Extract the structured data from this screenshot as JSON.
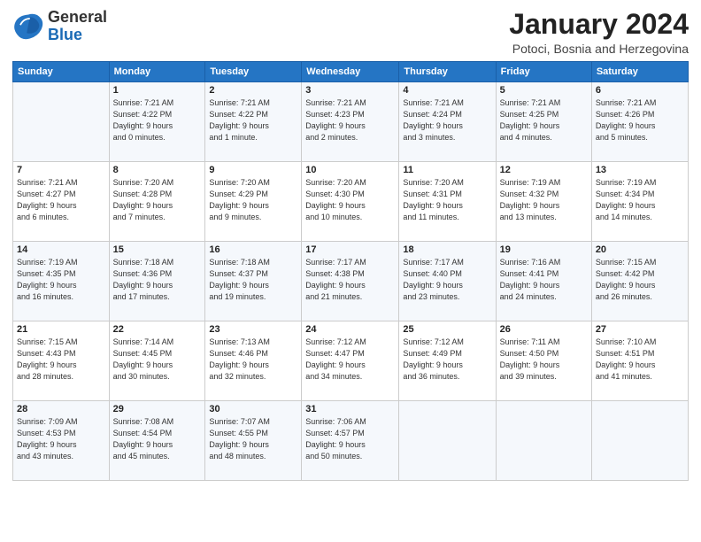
{
  "header": {
    "logo_general": "General",
    "logo_blue": "Blue",
    "month": "January 2024",
    "location": "Potoci, Bosnia and Herzegovina"
  },
  "weekdays": [
    "Sunday",
    "Monday",
    "Tuesday",
    "Wednesday",
    "Thursday",
    "Friday",
    "Saturday"
  ],
  "weeks": [
    [
      {
        "day": "",
        "info": ""
      },
      {
        "day": "1",
        "info": "Sunrise: 7:21 AM\nSunset: 4:22 PM\nDaylight: 9 hours\nand 0 minutes."
      },
      {
        "day": "2",
        "info": "Sunrise: 7:21 AM\nSunset: 4:22 PM\nDaylight: 9 hours\nand 1 minute."
      },
      {
        "day": "3",
        "info": "Sunrise: 7:21 AM\nSunset: 4:23 PM\nDaylight: 9 hours\nand 2 minutes."
      },
      {
        "day": "4",
        "info": "Sunrise: 7:21 AM\nSunset: 4:24 PM\nDaylight: 9 hours\nand 3 minutes."
      },
      {
        "day": "5",
        "info": "Sunrise: 7:21 AM\nSunset: 4:25 PM\nDaylight: 9 hours\nand 4 minutes."
      },
      {
        "day": "6",
        "info": "Sunrise: 7:21 AM\nSunset: 4:26 PM\nDaylight: 9 hours\nand 5 minutes."
      }
    ],
    [
      {
        "day": "7",
        "info": "Sunrise: 7:21 AM\nSunset: 4:27 PM\nDaylight: 9 hours\nand 6 minutes."
      },
      {
        "day": "8",
        "info": "Sunrise: 7:20 AM\nSunset: 4:28 PM\nDaylight: 9 hours\nand 7 minutes."
      },
      {
        "day": "9",
        "info": "Sunrise: 7:20 AM\nSunset: 4:29 PM\nDaylight: 9 hours\nand 9 minutes."
      },
      {
        "day": "10",
        "info": "Sunrise: 7:20 AM\nSunset: 4:30 PM\nDaylight: 9 hours\nand 10 minutes."
      },
      {
        "day": "11",
        "info": "Sunrise: 7:20 AM\nSunset: 4:31 PM\nDaylight: 9 hours\nand 11 minutes."
      },
      {
        "day": "12",
        "info": "Sunrise: 7:19 AM\nSunset: 4:32 PM\nDaylight: 9 hours\nand 13 minutes."
      },
      {
        "day": "13",
        "info": "Sunrise: 7:19 AM\nSunset: 4:34 PM\nDaylight: 9 hours\nand 14 minutes."
      }
    ],
    [
      {
        "day": "14",
        "info": "Sunrise: 7:19 AM\nSunset: 4:35 PM\nDaylight: 9 hours\nand 16 minutes."
      },
      {
        "day": "15",
        "info": "Sunrise: 7:18 AM\nSunset: 4:36 PM\nDaylight: 9 hours\nand 17 minutes."
      },
      {
        "day": "16",
        "info": "Sunrise: 7:18 AM\nSunset: 4:37 PM\nDaylight: 9 hours\nand 19 minutes."
      },
      {
        "day": "17",
        "info": "Sunrise: 7:17 AM\nSunset: 4:38 PM\nDaylight: 9 hours\nand 21 minutes."
      },
      {
        "day": "18",
        "info": "Sunrise: 7:17 AM\nSunset: 4:40 PM\nDaylight: 9 hours\nand 23 minutes."
      },
      {
        "day": "19",
        "info": "Sunrise: 7:16 AM\nSunset: 4:41 PM\nDaylight: 9 hours\nand 24 minutes."
      },
      {
        "day": "20",
        "info": "Sunrise: 7:15 AM\nSunset: 4:42 PM\nDaylight: 9 hours\nand 26 minutes."
      }
    ],
    [
      {
        "day": "21",
        "info": "Sunrise: 7:15 AM\nSunset: 4:43 PM\nDaylight: 9 hours\nand 28 minutes."
      },
      {
        "day": "22",
        "info": "Sunrise: 7:14 AM\nSunset: 4:45 PM\nDaylight: 9 hours\nand 30 minutes."
      },
      {
        "day": "23",
        "info": "Sunrise: 7:13 AM\nSunset: 4:46 PM\nDaylight: 9 hours\nand 32 minutes."
      },
      {
        "day": "24",
        "info": "Sunrise: 7:12 AM\nSunset: 4:47 PM\nDaylight: 9 hours\nand 34 minutes."
      },
      {
        "day": "25",
        "info": "Sunrise: 7:12 AM\nSunset: 4:49 PM\nDaylight: 9 hours\nand 36 minutes."
      },
      {
        "day": "26",
        "info": "Sunrise: 7:11 AM\nSunset: 4:50 PM\nDaylight: 9 hours\nand 39 minutes."
      },
      {
        "day": "27",
        "info": "Sunrise: 7:10 AM\nSunset: 4:51 PM\nDaylight: 9 hours\nand 41 minutes."
      }
    ],
    [
      {
        "day": "28",
        "info": "Sunrise: 7:09 AM\nSunset: 4:53 PM\nDaylight: 9 hours\nand 43 minutes."
      },
      {
        "day": "29",
        "info": "Sunrise: 7:08 AM\nSunset: 4:54 PM\nDaylight: 9 hours\nand 45 minutes."
      },
      {
        "day": "30",
        "info": "Sunrise: 7:07 AM\nSunset: 4:55 PM\nDaylight: 9 hours\nand 48 minutes."
      },
      {
        "day": "31",
        "info": "Sunrise: 7:06 AM\nSunset: 4:57 PM\nDaylight: 9 hours\nand 50 minutes."
      },
      {
        "day": "",
        "info": ""
      },
      {
        "day": "",
        "info": ""
      },
      {
        "day": "",
        "info": ""
      }
    ]
  ]
}
